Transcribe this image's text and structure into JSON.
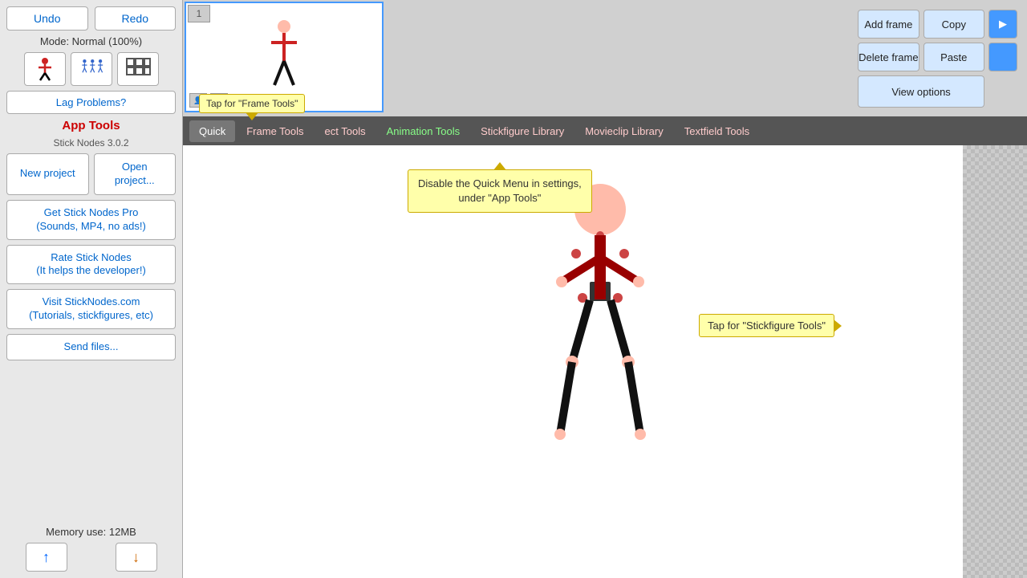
{
  "sidebar": {
    "undo_label": "Undo",
    "redo_label": "Redo",
    "mode_label": "Mode: Normal (100%)",
    "lag_btn": "Lag Problems?",
    "app_tools_title": "App Tools",
    "version": "Stick Nodes 3.0.2",
    "new_project": "New project",
    "open_project": "Open\nproject...",
    "get_pro": "Get Stick Nodes Pro\n(Sounds, MP4, no ads!)",
    "rate": "Rate Stick Nodes\n(It helps the developer!)",
    "visit": "Visit StickNodes.com\n(Tutorials, stickfigures, etc)",
    "send_files": "Send files...",
    "memory": "Memory use: 12MB"
  },
  "topbar": {
    "frame_number": "1",
    "add_frame": "Add frame",
    "copy": "Copy",
    "delete_frame": "Delete frame",
    "paste": "Paste",
    "view_options": "View options",
    "play_icon": "▶"
  },
  "toolbar": {
    "quick": "Quick",
    "frame_tools": "Frame Tools",
    "object_tools": "ect Tools",
    "animation_tools": "Animation Tools",
    "stickfigure_library": "Stickfigure Library",
    "movieclip_library": "Movieclip Library",
    "textfield_tools": "Textfield Tools"
  },
  "tooltips": {
    "frame_tools_tap": "Tap for \"Frame Tools\"",
    "disable_qm_line1": "Disable the Quick Menu in settings,",
    "disable_qm_line2": "under \"App Tools\"",
    "stickfig_tap": "Tap for \"Stickfigure Tools\""
  },
  "icons": {
    "person_red": "person-red-icon",
    "group_blue": "group-blue-icon",
    "grid": "grid-icon",
    "arrow_up": "↑",
    "arrow_down": "↓"
  },
  "colors": {
    "accent_blue": "#0066cc",
    "red_text": "#cc0000",
    "tab_bg": "#555555",
    "tooltip_bg": "#ffffaa",
    "tooltip_border": "#ccaa00"
  }
}
